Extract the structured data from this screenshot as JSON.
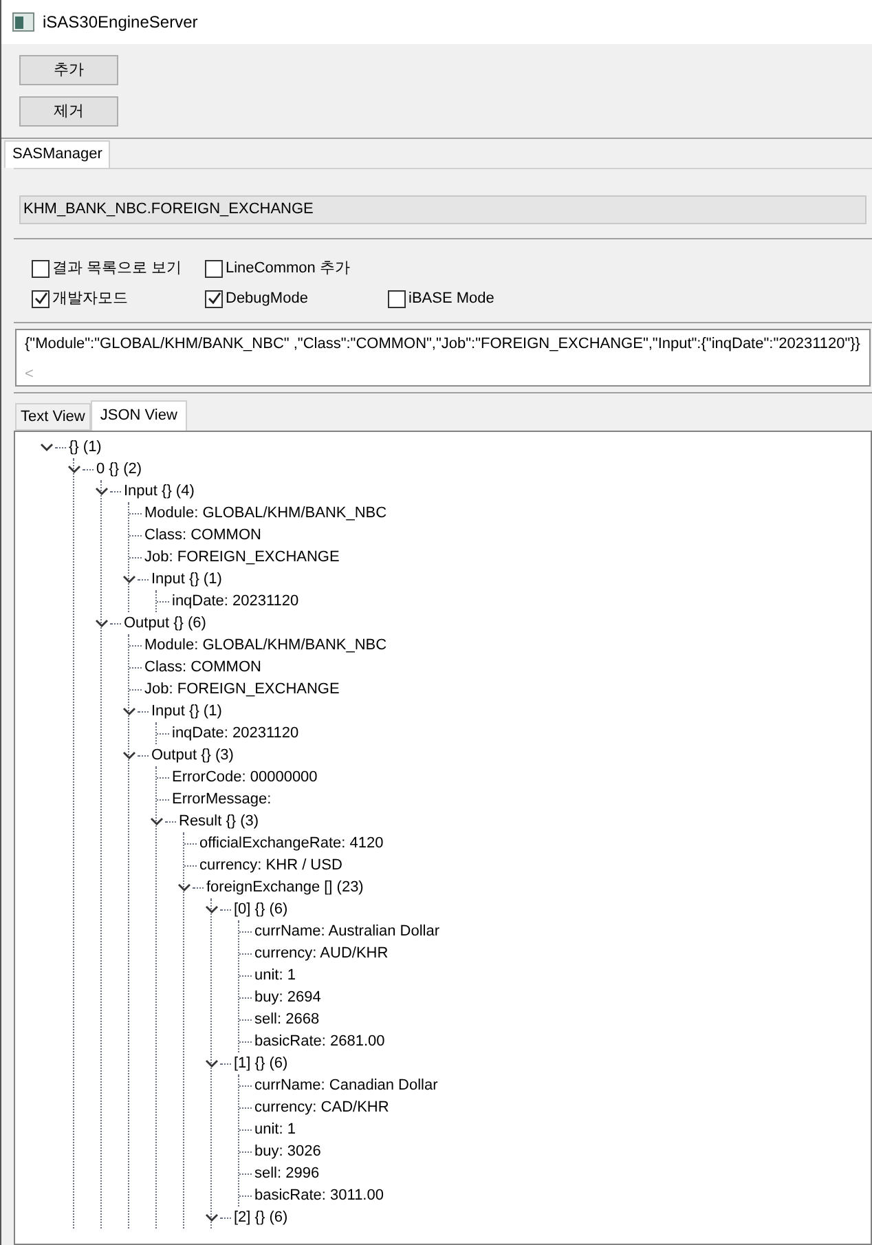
{
  "window": {
    "title": "iSAS30EngineServer"
  },
  "buttons": [
    "추가",
    "제거"
  ],
  "main_tabs": [
    {
      "label": "SASManager",
      "selected": true
    }
  ],
  "service_field": {
    "value": "KHM_BANK_NBC.FOREIGN_EXCHANGE"
  },
  "options": [
    {
      "label": "결과 목록으로 보기",
      "checked": false
    },
    {
      "label": "LineCommon 추가",
      "checked": false
    },
    {
      "label": "개발자모드",
      "checked": true
    },
    {
      "label": "DebugMode",
      "checked": true
    },
    {
      "label": "iBASE Mode",
      "checked": false
    }
  ],
  "request_text": {
    "value": "{\"Module\":\"GLOBAL/KHM/BANK_NBC\" ,\"Class\":\"COMMON\",\"Job\":\"FOREIGN_EXCHANGE\",\"Input\":{\"inqDate\":\"20231120\"}}",
    "scroll_left_arrow": "<"
  },
  "view_tabs": [
    {
      "label": "Text View",
      "selected": false
    },
    {
      "label": "JSON View",
      "selected": true
    }
  ],
  "tree": [
    {
      "label": "{} (1)",
      "expanded": true,
      "children": [
        {
          "label": "0 {} (2)",
          "expanded": true,
          "children": [
            {
              "label": "Input {} (4)",
              "expanded": true,
              "children": [
                {
                  "label": "Module: GLOBAL/KHM/BANK_NBC"
                },
                {
                  "label": "Class: COMMON"
                },
                {
                  "label": "Job: FOREIGN_EXCHANGE"
                },
                {
                  "label": "Input {} (1)",
                  "expanded": true,
                  "children": [
                    {
                      "label": "inqDate: 20231120"
                    }
                  ]
                }
              ]
            },
            {
              "label": "Output {} (6)",
              "expanded": true,
              "children": [
                {
                  "label": "Module: GLOBAL/KHM/BANK_NBC"
                },
                {
                  "label": "Class: COMMON"
                },
                {
                  "label": "Job: FOREIGN_EXCHANGE"
                },
                {
                  "label": "Input {} (1)",
                  "expanded": true,
                  "children": [
                    {
                      "label": "inqDate: 20231120"
                    }
                  ]
                },
                {
                  "label": "Output {} (3)",
                  "expanded": true,
                  "children": [
                    {
                      "label": "ErrorCode: 00000000"
                    },
                    {
                      "label": "ErrorMessage:"
                    },
                    {
                      "label": "Result {} (3)",
                      "expanded": true,
                      "children": [
                        {
                          "label": "officialExchangeRate: 4120"
                        },
                        {
                          "label": "currency: KHR / USD"
                        },
                        {
                          "label": "foreignExchange [] (23)",
                          "expanded": true,
                          "children": [
                            {
                              "label": "[0] {} (6)",
                              "expanded": true,
                              "children": [
                                {
                                  "label": "currName: Australian Dollar"
                                },
                                {
                                  "label": "currency: AUD/KHR"
                                },
                                {
                                  "label": "unit: 1"
                                },
                                {
                                  "label": "buy: 2694"
                                },
                                {
                                  "label": "sell: 2668"
                                },
                                {
                                  "label": "basicRate: 2681.00"
                                }
                              ]
                            },
                            {
                              "label": "[1] {} (6)",
                              "expanded": true,
                              "children": [
                                {
                                  "label": "currName: Canadian Dollar"
                                },
                                {
                                  "label": "currency: CAD/KHR"
                                },
                                {
                                  "label": "unit: 1"
                                },
                                {
                                  "label": "buy: 3026"
                                },
                                {
                                  "label": "sell: 2996"
                                },
                                {
                                  "label": "basicRate: 3011.00"
                                }
                              ]
                            },
                            {
                              "label": "[2] {} (6)",
                              "expanded": true
                            }
                          ]
                        }
                      ]
                    }
                  ]
                }
              ]
            }
          ]
        }
      ]
    }
  ]
}
